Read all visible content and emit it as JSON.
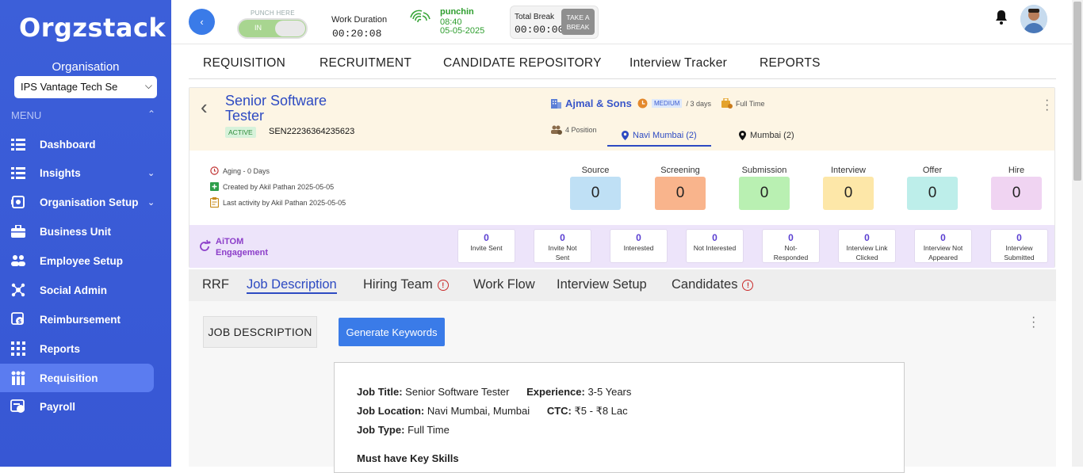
{
  "app": {
    "logo": "Orgzstack"
  },
  "sidebar": {
    "org_label": "Organisation",
    "org_select_value": "IPS Vantage Tech Se",
    "menu_label": "MENU",
    "items": [
      {
        "label": "Dashboard",
        "icon": "dashboard-icon"
      },
      {
        "label": "Insights",
        "icon": "insights-icon"
      },
      {
        "label": "Organisation Setup",
        "icon": "organisation-setup-icon"
      },
      {
        "label": "Business Unit",
        "icon": "briefcase-icon"
      },
      {
        "label": "Employee Setup",
        "icon": "users-icon"
      },
      {
        "label": "Social Admin",
        "icon": "social-admin-icon"
      },
      {
        "label": "Reimbursement",
        "icon": "reimbursement-icon"
      },
      {
        "label": "Reports",
        "icon": "reports-icon"
      },
      {
        "label": "Requisition",
        "icon": "requisition-icon"
      },
      {
        "label": "Payroll",
        "icon": "payroll-icon"
      }
    ]
  },
  "topbar": {
    "punch_here": "PUNCH HERE",
    "toggle_label": "IN",
    "work_duration_label": "Work Duration",
    "work_duration_value": "00:20:08",
    "punchin_label": "punchin",
    "punchin_time": "08:40",
    "punchin_date": "05-05-2025",
    "total_break_label": "Total Break",
    "total_break_value": "00:00:00",
    "take_break_line1": "TAKE A",
    "take_break_line2": "BREAK"
  },
  "main_nav": [
    "REQUISITION",
    "RECRUITMENT",
    "CANDIDATE REPOSITORY",
    "Interview Tracker",
    "REPORTS"
  ],
  "job": {
    "title": "Senior Software Tester",
    "status": "ACTIVE",
    "code": "SEN22236364235623",
    "client": "Ajmal & Sons",
    "priority": "MEDIUM",
    "duration": "/ 3 days",
    "job_type": "Full Time",
    "positions": "4 Position",
    "locations": [
      "Navi Mumbai (2)",
      "Mumbai (2)"
    ],
    "aging": "Aging - 0 Days",
    "created_by": "Created by Akil Pathan 2025-05-05",
    "last_activity": "Last activity by Akil Pathan 2025-05-05",
    "stages": [
      {
        "label": "Source",
        "value": "0",
        "color": "#bfe0f5"
      },
      {
        "label": "Screening",
        "value": "0",
        "color": "#f9b48c"
      },
      {
        "label": "Submission",
        "value": "0",
        "color": "#b9f0b2"
      },
      {
        "label": "Interview",
        "value": "0",
        "color": "#fde7a8"
      },
      {
        "label": "Offer",
        "value": "0",
        "color": "#bdeeea"
      },
      {
        "label": "Hire",
        "value": "0",
        "color": "#f0d4f2"
      }
    ]
  },
  "aitom": {
    "title_line1": "AiTOM",
    "title_line2": "Engagement",
    "metrics": [
      {
        "value": "0",
        "l1": "Invite Sent",
        "l2": ""
      },
      {
        "value": "0",
        "l1": "Invite Not",
        "l2": "Sent"
      },
      {
        "value": "0",
        "l1": "Interested",
        "l2": ""
      },
      {
        "value": "0",
        "l1": "Not Interested",
        "l2": ""
      },
      {
        "value": "0",
        "l1": "Not-",
        "l2": "Responded"
      },
      {
        "value": "0",
        "l1": "Interview Link",
        "l2": "Clicked"
      },
      {
        "value": "0",
        "l1": "Interview Not",
        "l2": "Appeared"
      },
      {
        "value": "0",
        "l1": "Interview",
        "l2": "Submitted"
      }
    ]
  },
  "sub_tabs": [
    "RRF",
    "Job Description",
    "Hiring Team",
    "Work Flow",
    "Interview Setup",
    "Candidates"
  ],
  "content": {
    "jd_button": "JOB DESCRIPTION",
    "generate_button": "Generate Keywords",
    "doc": {
      "job_title_label": "Job Title:",
      "job_title": "Senior Software Tester",
      "experience_label": "Experience:",
      "experience": "3-5 Years",
      "location_label": "Job Location:",
      "location": "Navi Mumbai, Mumbai",
      "ctc_label": "CTC:",
      "ctc": "₹5 - ₹8 Lac",
      "type_label": "Job Type:",
      "type": "Full Time",
      "skills_heading": "Must have Key Skills"
    }
  }
}
